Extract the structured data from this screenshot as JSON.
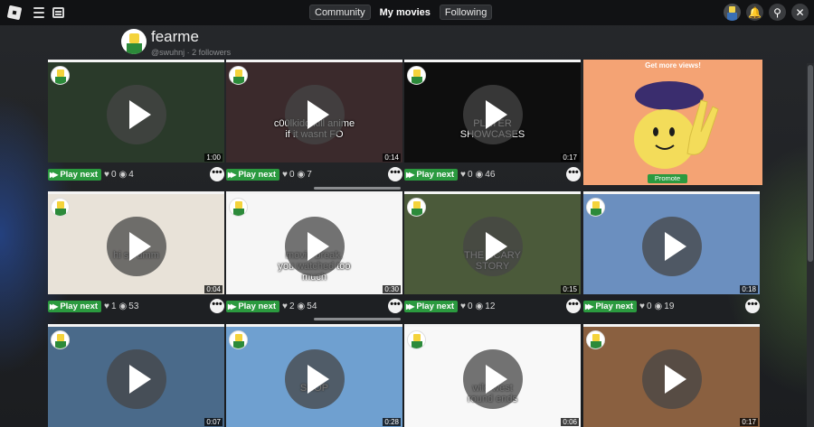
{
  "topbar": {
    "tabs": [
      {
        "label": "Community",
        "active": false
      },
      {
        "label": "My movies",
        "active": true
      },
      {
        "label": "Following",
        "active": false
      }
    ],
    "icons": [
      "roblox-logo-icon",
      "menu-icon",
      "chat-icon",
      "avatar-icon",
      "notification-icon",
      "search-icon",
      "close-icon"
    ]
  },
  "profile": {
    "name": "fearme",
    "meta": "@swuhnj · 2 followers"
  },
  "promo": {
    "title": "Get more views!",
    "button": "Promote"
  },
  "play_next_label": "Play next",
  "more_label": "•••",
  "movies": [
    {
      "text": "",
      "duration": "1:00",
      "likes": "0",
      "views": "4",
      "bg": "#2a3a2a"
    },
    {
      "text": "c00lkidd kill anime\nif it wasnt FO",
      "duration": "0:14",
      "likes": "0",
      "views": "7",
      "bg": "#3b2a2c"
    },
    {
      "text": "PLAYER\nSHOWCASES",
      "duration": "0:17",
      "likes": "0",
      "views": "46",
      "bg": "#0e0e0e"
    },
    {
      "text": "hi so umm",
      "duration": "0:04",
      "likes": "1",
      "views": "53",
      "bg": "#e8e2d8"
    },
    {
      "text": "movie break.\nyou watched too\nmuch",
      "duration": "0:30",
      "likes": "2",
      "views": "54",
      "bg": "#f6f6f6"
    },
    {
      "text": "THE SCARY\nSTORY",
      "duration": "0:15",
      "likes": "0",
      "views": "12",
      "bg": "#4b5a3a"
    },
    {
      "text": "",
      "duration": "0:18",
      "likes": "0",
      "views": "19",
      "bg": "#6b8fbf"
    },
    {
      "text": "",
      "duration": "0:07",
      "likes": "",
      "views": "",
      "bg": "#4a6a8a"
    },
    {
      "text": "SHOP",
      "duration": "0:28",
      "likes": "",
      "views": "",
      "bg": "#6fa0d0"
    },
    {
      "text": "wild west\nround ends",
      "duration": "0:06",
      "likes": "",
      "views": "",
      "bg": "#f8f8f8"
    },
    {
      "text": "",
      "duration": "0:17",
      "likes": "",
      "views": "",
      "bg": "#8a6040"
    }
  ]
}
